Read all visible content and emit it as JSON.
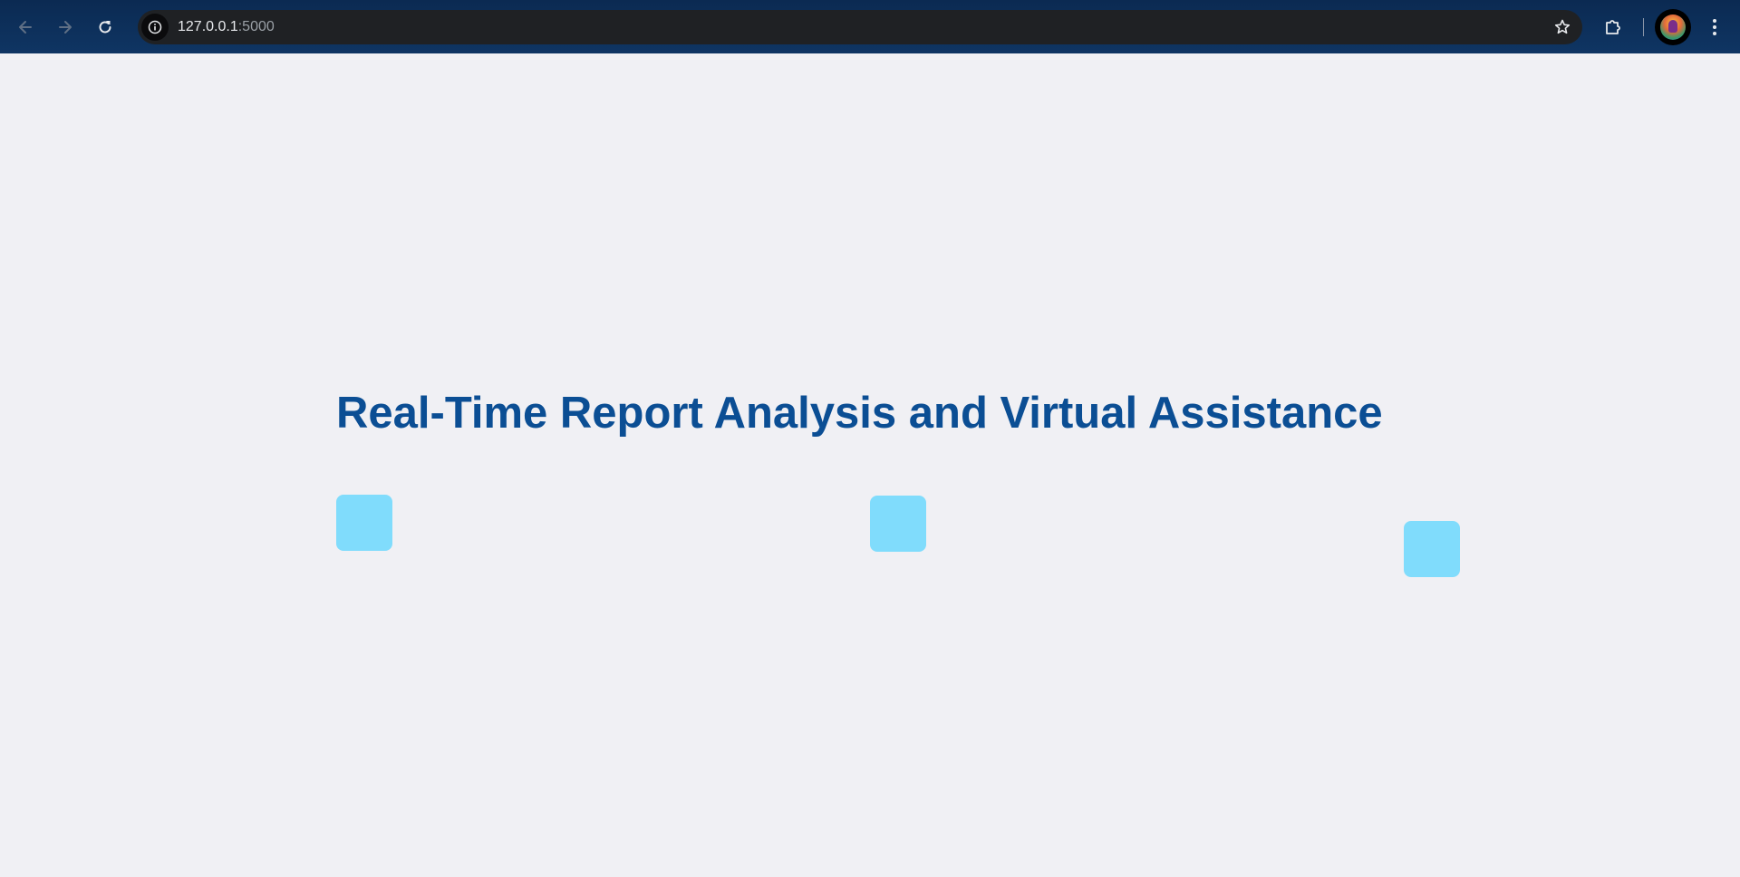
{
  "browser": {
    "url_host": "127.0.0.1",
    "url_port": ":5000",
    "icons": {
      "back": "arrow-left-icon",
      "forward": "arrow-right-icon",
      "reload": "reload-icon",
      "site_info": "info-icon",
      "bookmark": "star-icon",
      "extensions": "puzzle-icon",
      "menu": "kebab-menu-icon"
    }
  },
  "page": {
    "title": "Real-Time Report Analysis and Virtual Assistance",
    "title_color": "#0b4e94",
    "background_color": "#f0f0f4",
    "tile_color": "#80dcfc",
    "tiles": [
      "",
      "",
      ""
    ]
  }
}
